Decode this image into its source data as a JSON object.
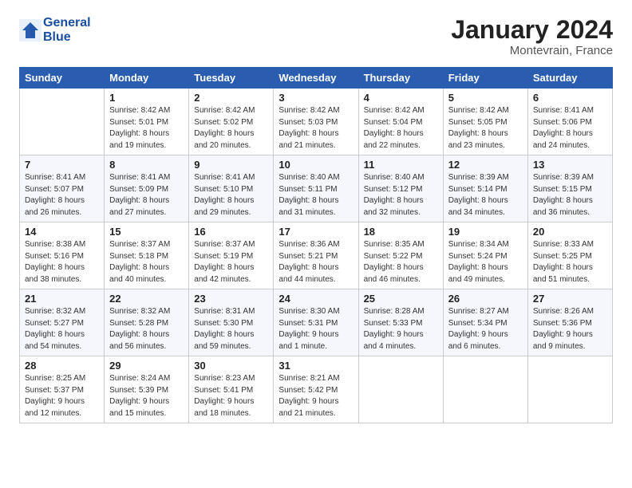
{
  "header": {
    "logo_line1": "General",
    "logo_line2": "Blue",
    "month": "January 2024",
    "location": "Montevrain, France"
  },
  "columns": [
    "Sunday",
    "Monday",
    "Tuesday",
    "Wednesday",
    "Thursday",
    "Friday",
    "Saturday"
  ],
  "weeks": [
    [
      {
        "day": "",
        "info": ""
      },
      {
        "day": "1",
        "info": "Sunrise: 8:42 AM\nSunset: 5:01 PM\nDaylight: 8 hours\nand 19 minutes."
      },
      {
        "day": "2",
        "info": "Sunrise: 8:42 AM\nSunset: 5:02 PM\nDaylight: 8 hours\nand 20 minutes."
      },
      {
        "day": "3",
        "info": "Sunrise: 8:42 AM\nSunset: 5:03 PM\nDaylight: 8 hours\nand 21 minutes."
      },
      {
        "day": "4",
        "info": "Sunrise: 8:42 AM\nSunset: 5:04 PM\nDaylight: 8 hours\nand 22 minutes."
      },
      {
        "day": "5",
        "info": "Sunrise: 8:42 AM\nSunset: 5:05 PM\nDaylight: 8 hours\nand 23 minutes."
      },
      {
        "day": "6",
        "info": "Sunrise: 8:41 AM\nSunset: 5:06 PM\nDaylight: 8 hours\nand 24 minutes."
      }
    ],
    [
      {
        "day": "7",
        "info": "Sunrise: 8:41 AM\nSunset: 5:07 PM\nDaylight: 8 hours\nand 26 minutes."
      },
      {
        "day": "8",
        "info": "Sunrise: 8:41 AM\nSunset: 5:09 PM\nDaylight: 8 hours\nand 27 minutes."
      },
      {
        "day": "9",
        "info": "Sunrise: 8:41 AM\nSunset: 5:10 PM\nDaylight: 8 hours\nand 29 minutes."
      },
      {
        "day": "10",
        "info": "Sunrise: 8:40 AM\nSunset: 5:11 PM\nDaylight: 8 hours\nand 31 minutes."
      },
      {
        "day": "11",
        "info": "Sunrise: 8:40 AM\nSunset: 5:12 PM\nDaylight: 8 hours\nand 32 minutes."
      },
      {
        "day": "12",
        "info": "Sunrise: 8:39 AM\nSunset: 5:14 PM\nDaylight: 8 hours\nand 34 minutes."
      },
      {
        "day": "13",
        "info": "Sunrise: 8:39 AM\nSunset: 5:15 PM\nDaylight: 8 hours\nand 36 minutes."
      }
    ],
    [
      {
        "day": "14",
        "info": "Sunrise: 8:38 AM\nSunset: 5:16 PM\nDaylight: 8 hours\nand 38 minutes."
      },
      {
        "day": "15",
        "info": "Sunrise: 8:37 AM\nSunset: 5:18 PM\nDaylight: 8 hours\nand 40 minutes."
      },
      {
        "day": "16",
        "info": "Sunrise: 8:37 AM\nSunset: 5:19 PM\nDaylight: 8 hours\nand 42 minutes."
      },
      {
        "day": "17",
        "info": "Sunrise: 8:36 AM\nSunset: 5:21 PM\nDaylight: 8 hours\nand 44 minutes."
      },
      {
        "day": "18",
        "info": "Sunrise: 8:35 AM\nSunset: 5:22 PM\nDaylight: 8 hours\nand 46 minutes."
      },
      {
        "day": "19",
        "info": "Sunrise: 8:34 AM\nSunset: 5:24 PM\nDaylight: 8 hours\nand 49 minutes."
      },
      {
        "day": "20",
        "info": "Sunrise: 8:33 AM\nSunset: 5:25 PM\nDaylight: 8 hours\nand 51 minutes."
      }
    ],
    [
      {
        "day": "21",
        "info": "Sunrise: 8:32 AM\nSunset: 5:27 PM\nDaylight: 8 hours\nand 54 minutes."
      },
      {
        "day": "22",
        "info": "Sunrise: 8:32 AM\nSunset: 5:28 PM\nDaylight: 8 hours\nand 56 minutes."
      },
      {
        "day": "23",
        "info": "Sunrise: 8:31 AM\nSunset: 5:30 PM\nDaylight: 8 hours\nand 59 minutes."
      },
      {
        "day": "24",
        "info": "Sunrise: 8:30 AM\nSunset: 5:31 PM\nDaylight: 9 hours\nand 1 minute."
      },
      {
        "day": "25",
        "info": "Sunrise: 8:28 AM\nSunset: 5:33 PM\nDaylight: 9 hours\nand 4 minutes."
      },
      {
        "day": "26",
        "info": "Sunrise: 8:27 AM\nSunset: 5:34 PM\nDaylight: 9 hours\nand 6 minutes."
      },
      {
        "day": "27",
        "info": "Sunrise: 8:26 AM\nSunset: 5:36 PM\nDaylight: 9 hours\nand 9 minutes."
      }
    ],
    [
      {
        "day": "28",
        "info": "Sunrise: 8:25 AM\nSunset: 5:37 PM\nDaylight: 9 hours\nand 12 minutes."
      },
      {
        "day": "29",
        "info": "Sunrise: 8:24 AM\nSunset: 5:39 PM\nDaylight: 9 hours\nand 15 minutes."
      },
      {
        "day": "30",
        "info": "Sunrise: 8:23 AM\nSunset: 5:41 PM\nDaylight: 9 hours\nand 18 minutes."
      },
      {
        "day": "31",
        "info": "Sunrise: 8:21 AM\nSunset: 5:42 PM\nDaylight: 9 hours\nand 21 minutes."
      },
      {
        "day": "",
        "info": ""
      },
      {
        "day": "",
        "info": ""
      },
      {
        "day": "",
        "info": ""
      }
    ]
  ]
}
